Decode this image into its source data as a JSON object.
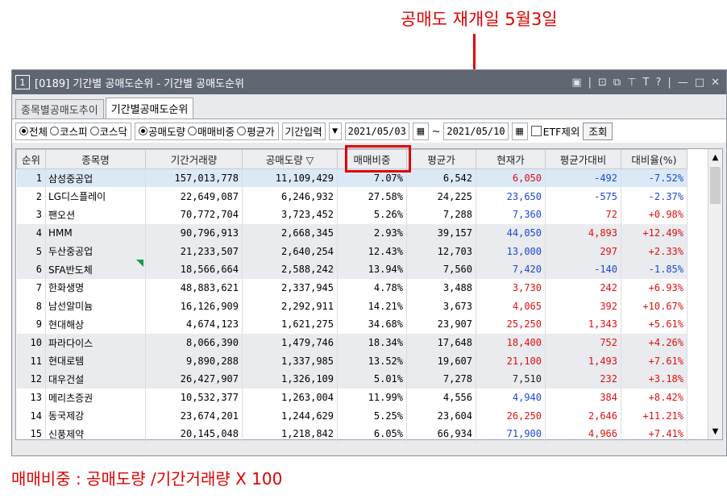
{
  "annotations": {
    "top": "공매도 재개일 5월3일",
    "bottom": "매매비중 : 공매도량 /기간거래량 X 100"
  },
  "window": {
    "badge": "1",
    "title": "[0189] 기간별 공매도순위 - 기간별 공매도순위",
    "icons": [
      "▣",
      "|",
      "⊡",
      "⧉",
      "⊤",
      "T",
      "?",
      "|",
      "—",
      "□",
      "✕"
    ]
  },
  "tabs": [
    {
      "label": "종목별공매도추이",
      "active": false
    },
    {
      "label": "기간별공매도순위",
      "active": true
    }
  ],
  "filters": {
    "market": [
      {
        "label": "전체",
        "checked": true
      },
      {
        "label": "코스피",
        "checked": false
      },
      {
        "label": "코스닥",
        "checked": false
      }
    ],
    "sort": [
      {
        "label": "공매도량",
        "checked": true
      },
      {
        "label": "매매비중",
        "checked": false
      },
      {
        "label": "평균가",
        "checked": false
      }
    ],
    "period_select": "기간입력",
    "start_date": "2021/05/03",
    "tilde": "~",
    "end_date": "2021/05/10",
    "etf_label": "ETF제외",
    "query_button": "조회"
  },
  "table": {
    "headers": [
      "순위",
      "종목명",
      "기간거래량",
      "공매도량 ▽",
      "매매비중",
      "평균가",
      "현재가",
      "평균가대비",
      "대비율(%)"
    ],
    "rows": [
      {
        "rank": "1",
        "name": "삼성중공업",
        "volume": "157,013,778",
        "short": "11,109,429",
        "ratio": "7.07%",
        "avg": "6,542",
        "price": "6,050",
        "price_color": "red",
        "diff": "-492",
        "diff_color": "blue",
        "rate": "-7.52%",
        "rate_color": "blue",
        "style": "sel"
      },
      {
        "rank": "2",
        "name": "LG디스플레이",
        "volume": "22,649,087",
        "short": "6,246,932",
        "ratio": "27.58%",
        "avg": "24,225",
        "price": "23,650",
        "price_color": "blue",
        "diff": "-575",
        "diff_color": "blue",
        "rate": "-2.37%",
        "rate_color": "blue",
        "style": ""
      },
      {
        "rank": "3",
        "name": "팬오션",
        "volume": "70,772,704",
        "short": "3,723,452",
        "ratio": "5.26%",
        "avg": "7,288",
        "price": "7,360",
        "price_color": "blue",
        "diff": "72",
        "diff_color": "red",
        "rate": "+0.98%",
        "rate_color": "red",
        "style": ""
      },
      {
        "rank": "4",
        "name": "HMM",
        "volume": "90,796,913",
        "short": "2,668,345",
        "ratio": "2.93%",
        "avg": "39,157",
        "price": "44,050",
        "price_color": "blue",
        "diff": "4,893",
        "diff_color": "red",
        "rate": "+12.49%",
        "rate_color": "red",
        "style": "gray"
      },
      {
        "rank": "5",
        "name": "두산중공업",
        "volume": "21,233,507",
        "short": "2,640,254",
        "ratio": "12.43%",
        "avg": "12,703",
        "price": "13,000",
        "price_color": "blue",
        "diff": "297",
        "diff_color": "red",
        "rate": "+2.33%",
        "rate_color": "red",
        "style": "gray"
      },
      {
        "rank": "6",
        "name": "SFA반도체",
        "volume": "18,566,664",
        "short": "2,588,242",
        "ratio": "13.94%",
        "avg": "7,560",
        "price": "7,420",
        "price_color": "blue",
        "diff": "-140",
        "diff_color": "blue",
        "rate": "-1.85%",
        "rate_color": "blue",
        "style": "gray"
      },
      {
        "rank": "7",
        "name": "한화생명",
        "volume": "48,883,621",
        "short": "2,337,945",
        "ratio": "4.78%",
        "avg": "3,488",
        "price": "3,730",
        "price_color": "red",
        "diff": "242",
        "diff_color": "red",
        "rate": "+6.93%",
        "rate_color": "red",
        "style": ""
      },
      {
        "rank": "8",
        "name": "남선알미늄",
        "volume": "16,126,909",
        "short": "2,292,911",
        "ratio": "14.21%",
        "avg": "3,673",
        "price": "4,065",
        "price_color": "red",
        "diff": "392",
        "diff_color": "red",
        "rate": "+10.67%",
        "rate_color": "red",
        "style": ""
      },
      {
        "rank": "9",
        "name": "현대해상",
        "volume": "4,674,123",
        "short": "1,621,275",
        "ratio": "34.68%",
        "avg": "23,907",
        "price": "25,250",
        "price_color": "red",
        "diff": "1,343",
        "diff_color": "red",
        "rate": "+5.61%",
        "rate_color": "red",
        "style": ""
      },
      {
        "rank": "10",
        "name": "파라다이스",
        "volume": "8,066,390",
        "short": "1,479,746",
        "ratio": "18.34%",
        "avg": "17,648",
        "price": "18,400",
        "price_color": "red",
        "diff": "752",
        "diff_color": "red",
        "rate": "+4.26%",
        "rate_color": "red",
        "style": "gray"
      },
      {
        "rank": "11",
        "name": "현대로템",
        "volume": "9,890,288",
        "short": "1,337,985",
        "ratio": "13.52%",
        "avg": "19,607",
        "price": "21,100",
        "price_color": "red",
        "diff": "1,493",
        "diff_color": "red",
        "rate": "+7.61%",
        "rate_color": "red",
        "style": "gray"
      },
      {
        "rank": "12",
        "name": "대우건설",
        "volume": "26,427,907",
        "short": "1,326,109",
        "ratio": "5.01%",
        "avg": "7,278",
        "price": "7,510",
        "price_color": "black",
        "diff": "232",
        "diff_color": "red",
        "rate": "+3.18%",
        "rate_color": "red",
        "style": "gray"
      },
      {
        "rank": "13",
        "name": "메리츠증권",
        "volume": "10,532,377",
        "short": "1,263,004",
        "ratio": "11.99%",
        "avg": "4,556",
        "price": "4,940",
        "price_color": "blue",
        "diff": "384",
        "diff_color": "red",
        "rate": "+8.42%",
        "rate_color": "red",
        "style": ""
      },
      {
        "rank": "14",
        "name": "동국제강",
        "volume": "23,674,201",
        "short": "1,244,629",
        "ratio": "5.25%",
        "avg": "23,604",
        "price": "26,250",
        "price_color": "red",
        "diff": "2,646",
        "diff_color": "red",
        "rate": "+11.21%",
        "rate_color": "red",
        "style": ""
      },
      {
        "rank": "15",
        "name": "신풍제약",
        "volume": "20,145,048",
        "short": "1,218,842",
        "ratio": "6.05%",
        "avg": "66,934",
        "price": "71,900",
        "price_color": "blue",
        "diff": "4,966",
        "diff_color": "red",
        "rate": "+7.41%",
        "rate_color": "red",
        "style": ""
      }
    ]
  },
  "colors": {
    "red": "#e01010",
    "blue": "#1d48d6",
    "highlight": "#e00000",
    "titlebar": "#5f6773"
  }
}
